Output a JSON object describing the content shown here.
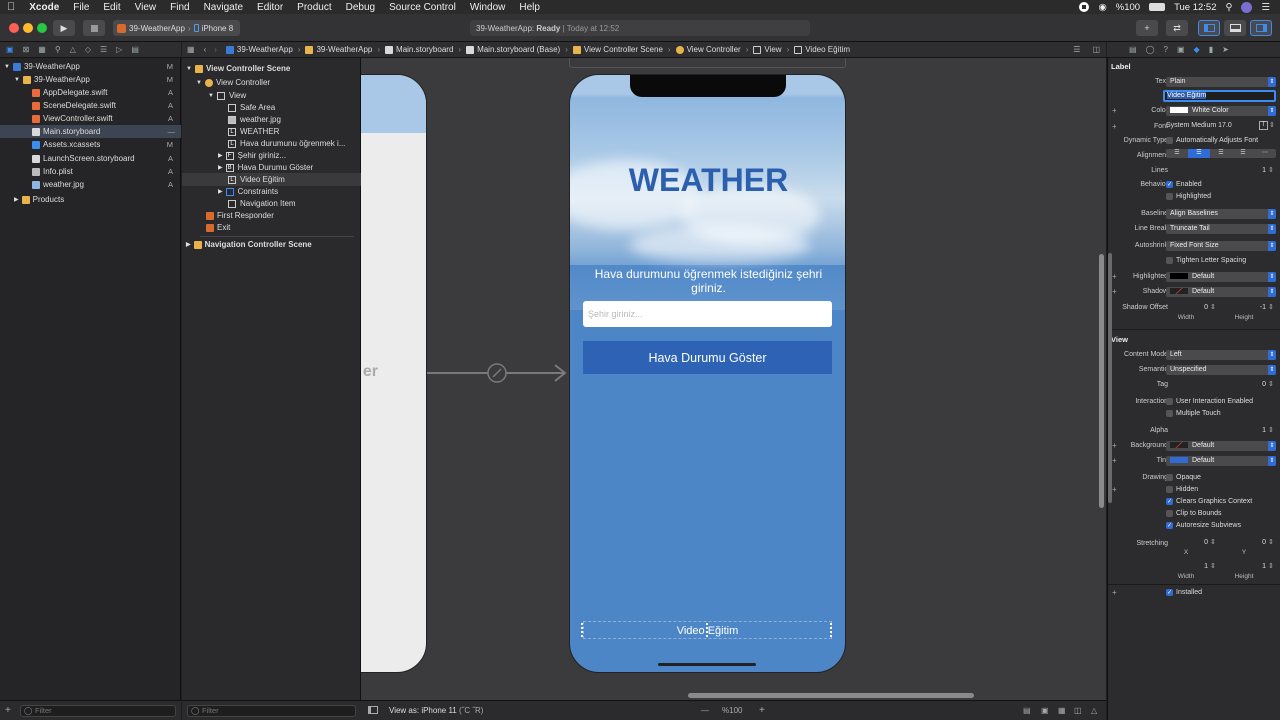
{
  "menubar": {
    "apple": "",
    "items": [
      "Xcode",
      "File",
      "Edit",
      "View",
      "Find",
      "Navigate",
      "Editor",
      "Product",
      "Debug",
      "Source Control",
      "Window",
      "Help"
    ],
    "battery": "%100",
    "clock": "Tue 12:52"
  },
  "toolbar": {
    "scheme": "39-WeatherApp",
    "device": "iPhone 8",
    "status_app": "39-WeatherApp:",
    "status_state": "Ready",
    "status_time": "| Today at 12:52"
  },
  "jumpbar": {
    "crumbs": [
      "39-WeatherApp",
      "39-WeatherApp",
      "Main.storyboard",
      "Main.storyboard (Base)",
      "View Controller Scene",
      "View Controller",
      "View",
      "Video Eğitim"
    ]
  },
  "navigator": {
    "project": {
      "label": "39-WeatherApp",
      "badge": "M"
    },
    "group": {
      "label": "39-WeatherApp",
      "badge": "M"
    },
    "files": [
      {
        "label": "AppDelegate.swift",
        "badge": "A"
      },
      {
        "label": "SceneDelegate.swift",
        "badge": "A"
      },
      {
        "label": "ViewController.swift",
        "badge": "A"
      },
      {
        "label": "Main.storyboard",
        "badge": "—"
      },
      {
        "label": "Assets.xcassets",
        "badge": "M"
      },
      {
        "label": "LaunchScreen.storyboard",
        "badge": "A"
      },
      {
        "label": "Info.plist",
        "badge": "A"
      },
      {
        "label": "weather.jpg",
        "badge": "A"
      }
    ],
    "products": "Products",
    "filter_placeholder": "Filter"
  },
  "outline": {
    "scene": "View Controller Scene",
    "vc": "View Controller",
    "view": "View",
    "children": [
      "Safe Area",
      "weather.jpg",
      "WEATHER",
      "Hava durumunu öğrenmek i...",
      "Şehir giriniz...",
      "Hava Durumu Göster",
      "Video Eğitim",
      "Constraints"
    ],
    "nav_item": "Navigation Item",
    "first_responder": "First Responder",
    "exit": "Exit",
    "nav_scene": "Navigation Controller Scene",
    "filter_placeholder": "Filter"
  },
  "canvas": {
    "left_scene_text": "er",
    "title": "WEATHER",
    "subtitle": "Hava durumunu öğrenmek istediğiniz şehri giriniz.",
    "city_placeholder": "Şehir giriniz...",
    "button": "Hava Durumu Göster",
    "video_label": "Video Eğitim",
    "view_as": "View as: iPhone 11",
    "view_as_suffix": "(˝C ˝R)",
    "zoom": "%100",
    "minus": "—",
    "plus": "+"
  },
  "inspector": {
    "label_section": "Label",
    "text_label": "Text",
    "text_value": "Plain",
    "text_field": "Video Eğitim",
    "color_label": "Color",
    "color_value": "White Color",
    "font_label": "Font",
    "font_value": "System Medium 17.0",
    "dyn_label": "Dynamic Type",
    "dyn_value": "Automatically Adjusts Font",
    "align_label": "Alignment",
    "lines_label": "Lines",
    "lines_value": "1",
    "behavior_label": "Behavior",
    "enabled": "Enabled",
    "highlighted_chk": "Highlighted",
    "baseline_label": "Baseline",
    "baseline_value": "Align Baselines",
    "linebreak_label": "Line Break",
    "linebreak_value": "Truncate Tail",
    "autoshrink_label": "Autoshrink",
    "autoshrink_value": "Fixed Font Size",
    "tighten": "Tighten Letter Spacing",
    "highlighted_label": "Highlighted",
    "highlighted_value": "Default",
    "shadow_label": "Shadow",
    "shadow_value": "Default",
    "shadow_offset_label": "Shadow Offset",
    "shadow_w": "0",
    "shadow_h": "-1",
    "width": "Width",
    "height": "Height",
    "view_section": "View",
    "content_mode_label": "Content Mode",
    "content_mode_value": "Left",
    "semantic_label": "Semantic",
    "semantic_value": "Unspecified",
    "tag_label": "Tag",
    "tag_value": "0",
    "interaction_label": "Interaction",
    "user_interaction": "User Interaction Enabled",
    "multiple_touch": "Multiple Touch",
    "alpha_label": "Alpha",
    "alpha_value": "1",
    "background_label": "Background",
    "background_value": "Default",
    "tint_label": "Tint",
    "tint_value": "Default",
    "drawing_label": "Drawing",
    "opaque": "Opaque",
    "hidden": "Hidden",
    "clears": "Clears Graphics Context",
    "clip": "Clip to Bounds",
    "autoresize": "Autoresize Subviews",
    "stretching_label": "Stretching",
    "sx": "0",
    "sy": "0",
    "sw": "1",
    "sh": "1",
    "x": "X",
    "y": "Y",
    "installed": "Installed"
  },
  "colors": {
    "accent": "#2f6cd6",
    "phone_blue": "#4d86c6",
    "title_blue": "#2c5fae",
    "button_blue": "#2d62b4"
  }
}
